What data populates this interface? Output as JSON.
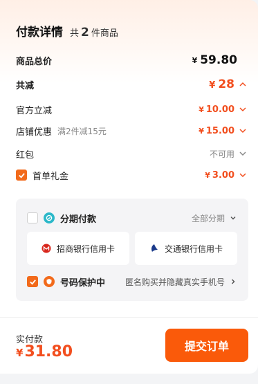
{
  "header": {
    "title": "付款详情",
    "count_prefix": "共",
    "count": "2",
    "count_suffix": "件商品"
  },
  "summary": {
    "subtotal_label": "商品总价",
    "subtotal_currency": "¥",
    "subtotal_value": "59.80",
    "discount_label": "共减",
    "discount_currency": "¥",
    "discount_value": "28"
  },
  "discounts": [
    {
      "label": "官方立减",
      "note": "",
      "currency": "¥",
      "value": "10.00"
    },
    {
      "label": "店铺优惠",
      "note": "满2件减15元",
      "currency": "¥",
      "value": "15.00"
    }
  ],
  "red_packet": {
    "label": "红包",
    "status": "不可用"
  },
  "first_order": {
    "label": "首单礼金",
    "currency": "¥",
    "value": "3.00",
    "checked": true
  },
  "installment": {
    "title": "分期付款",
    "option": "全部分期",
    "checked": false,
    "banks": [
      {
        "name": "招商银行信用卡",
        "icon": "cmb-bank-icon"
      },
      {
        "name": "交通银行信用卡",
        "icon": "bocom-bank-icon"
      }
    ]
  },
  "privacy": {
    "title": "号码保护中",
    "description": "匿名购买并隐藏真实手机号",
    "checked": true
  },
  "footer": {
    "pay_label": "实付款",
    "pay_currency": "¥",
    "pay_value": "31.80",
    "submit_label": "提交订单"
  },
  "colors": {
    "accent": "#fa5a0a",
    "price": "#f24e1e",
    "box_bg": "#f4f4f6"
  }
}
